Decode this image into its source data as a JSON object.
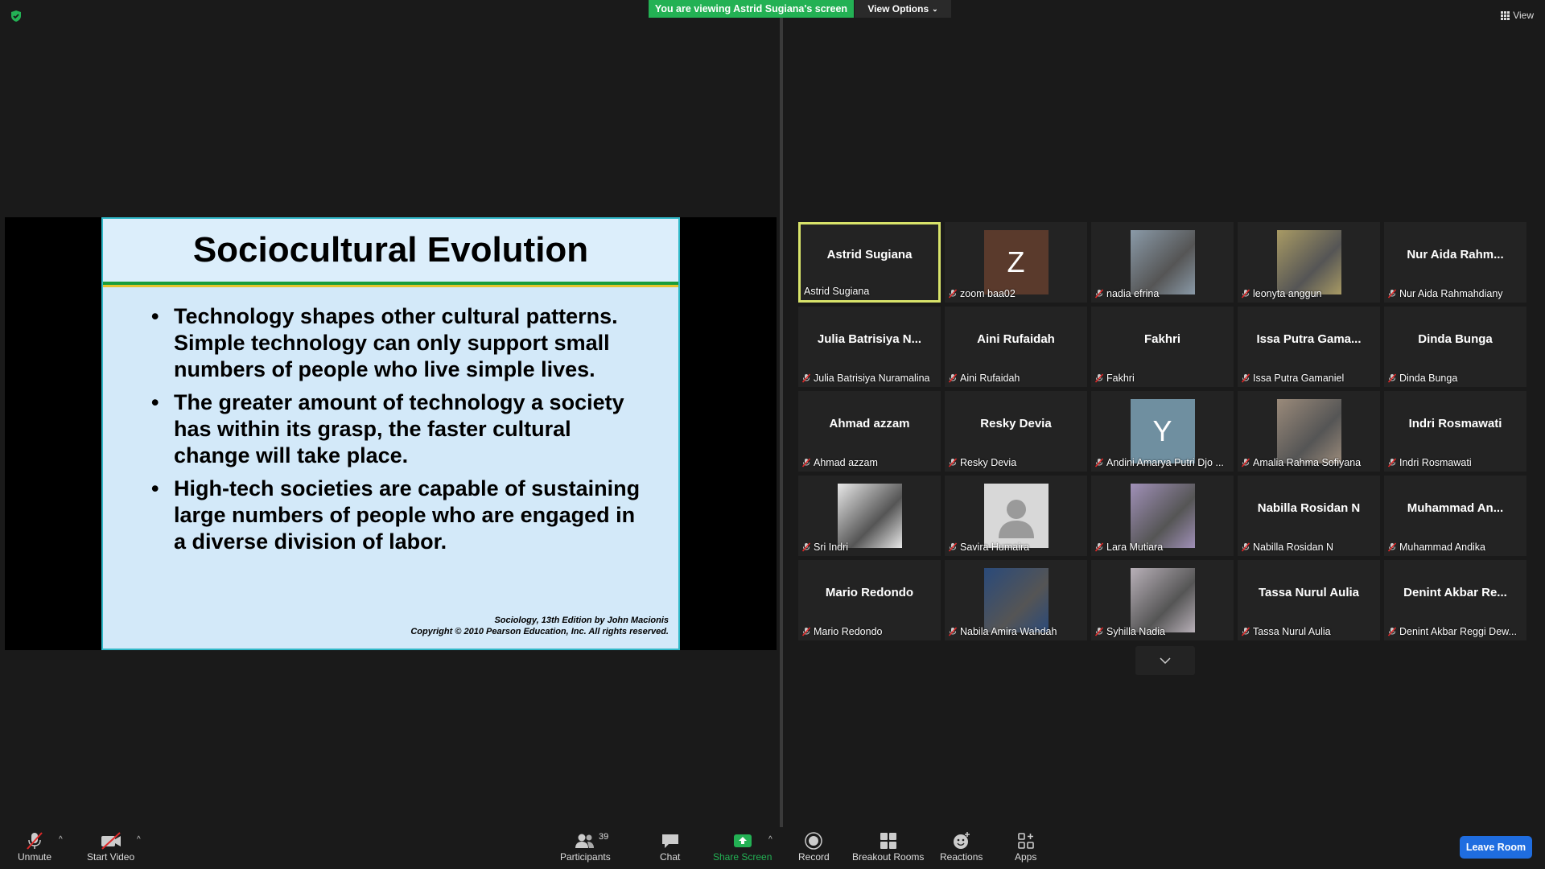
{
  "banner": {
    "viewing": "You are viewing Astrid Sugiana's screen",
    "view_options": "View Options"
  },
  "view_label": "View",
  "slide": {
    "title": "Sociocultural Evolution",
    "bullets": [
      "Technology shapes other cultural patterns. Simple technology can only support small numbers of people who live simple lives.",
      "The greater amount of technology a society has within its grasp, the faster cultural change will take place.",
      "High-tech societies are capable of sustaining large numbers of people who are engaged in a diverse division of labor."
    ],
    "footer_line1": "Sociology, 13th Edition by John Macionis",
    "footer_line2": "Copyright © 2010 Pearson Education, Inc.  All rights reserved."
  },
  "participants": [
    {
      "display": "Astrid Sugiana",
      "name": "Astrid Sugiana",
      "thumb": "",
      "active": true,
      "muted": false
    },
    {
      "display": "",
      "name": "zoom baa02",
      "thumb": "Z",
      "thumb_color": "#5a3a2c",
      "muted": true
    },
    {
      "display": "",
      "name": "nadia efrina",
      "thumb": "photo",
      "thumb_color": "#8a9aa8",
      "muted": true
    },
    {
      "display": "",
      "name": "leonyta anggun",
      "thumb": "photo",
      "thumb_color": "#a89a64",
      "muted": true
    },
    {
      "display": "Nur Aida Rahm...",
      "name": "Nur Aida Rahmahdiany",
      "thumb": "",
      "muted": true
    },
    {
      "display": "Julia Batrisiya N...",
      "name": "Julia Batrisiya Nuramalina",
      "thumb": "",
      "muted": true
    },
    {
      "display": "Aini Rufaidah",
      "name": "Aini Rufaidah",
      "thumb": "",
      "muted": true
    },
    {
      "display": "Fakhri",
      "name": "Fakhri",
      "thumb": "",
      "muted": true
    },
    {
      "display": "Issa Putra Gama...",
      "name": "Issa Putra Gamaniel",
      "thumb": "",
      "muted": true
    },
    {
      "display": "Dinda Bunga",
      "name": "Dinda Bunga",
      "thumb": "",
      "muted": true
    },
    {
      "display": "Ahmad azzam",
      "name": "Ahmad azzam",
      "thumb": "",
      "muted": true
    },
    {
      "display": "Resky Devia",
      "name": "Resky Devia",
      "thumb": "",
      "muted": true
    },
    {
      "display": "",
      "name": "Andini Amarya Putri Djo ...",
      "thumb": "Y",
      "thumb_color": "#6f8fa0",
      "muted": true
    },
    {
      "display": "",
      "name": "Amalia Rahma Sofiyana",
      "thumb": "photo",
      "thumb_color": "#9a8a7a",
      "muted": true
    },
    {
      "display": "Indri Rosmawati",
      "name": "Indri Rosmawati",
      "thumb": "",
      "muted": true
    },
    {
      "display": "",
      "name": "Sri Indri",
      "thumb": "photo",
      "thumb_color": "#e8e8e8",
      "muted": true
    },
    {
      "display": "",
      "name": "Savira Humaira",
      "thumb": "avatar",
      "thumb_color": "#d8d8d8",
      "muted": true
    },
    {
      "display": "",
      "name": "Lara Mutiara",
      "thumb": "photo",
      "thumb_color": "#a090b8",
      "muted": true
    },
    {
      "display": "Nabilla Rosidan N",
      "name": "Nabilla Rosidan N",
      "thumb": "",
      "muted": true
    },
    {
      "display": "Muhammad  An...",
      "name": "Muhammad Andika",
      "thumb": "",
      "muted": true
    },
    {
      "display": "Mario Redondo",
      "name": "Mario Redondo",
      "thumb": "",
      "muted": true
    },
    {
      "display": "",
      "name": "Nabila Amira Wahdah",
      "thumb": "photo",
      "thumb_color": "#2a4a7a",
      "muted": true
    },
    {
      "display": "",
      "name": "Syhilla Nadia",
      "thumb": "photo",
      "thumb_color": "#b8b0b8",
      "muted": true
    },
    {
      "display": "Tassa Nurul Aulia",
      "name": "Tassa Nurul Aulia",
      "thumb": "",
      "muted": true
    },
    {
      "display": "Denint Akbar Re...",
      "name": "Denint Akbar Reggi Dew...",
      "thumb": "",
      "muted": true
    }
  ],
  "toolbar": {
    "unmute": "Unmute",
    "start_video": "Start Video",
    "participants": "Participants",
    "participants_count": "39",
    "chat": "Chat",
    "share_screen": "Share Screen",
    "record": "Record",
    "breakout_rooms": "Breakout Rooms",
    "reactions": "Reactions",
    "apps": "Apps",
    "leave_room": "Leave Room"
  },
  "colors": {
    "banner": "#23b154",
    "active_border": "#d8e36a",
    "leave": "#1f6de0",
    "share_green": "#23b154"
  }
}
